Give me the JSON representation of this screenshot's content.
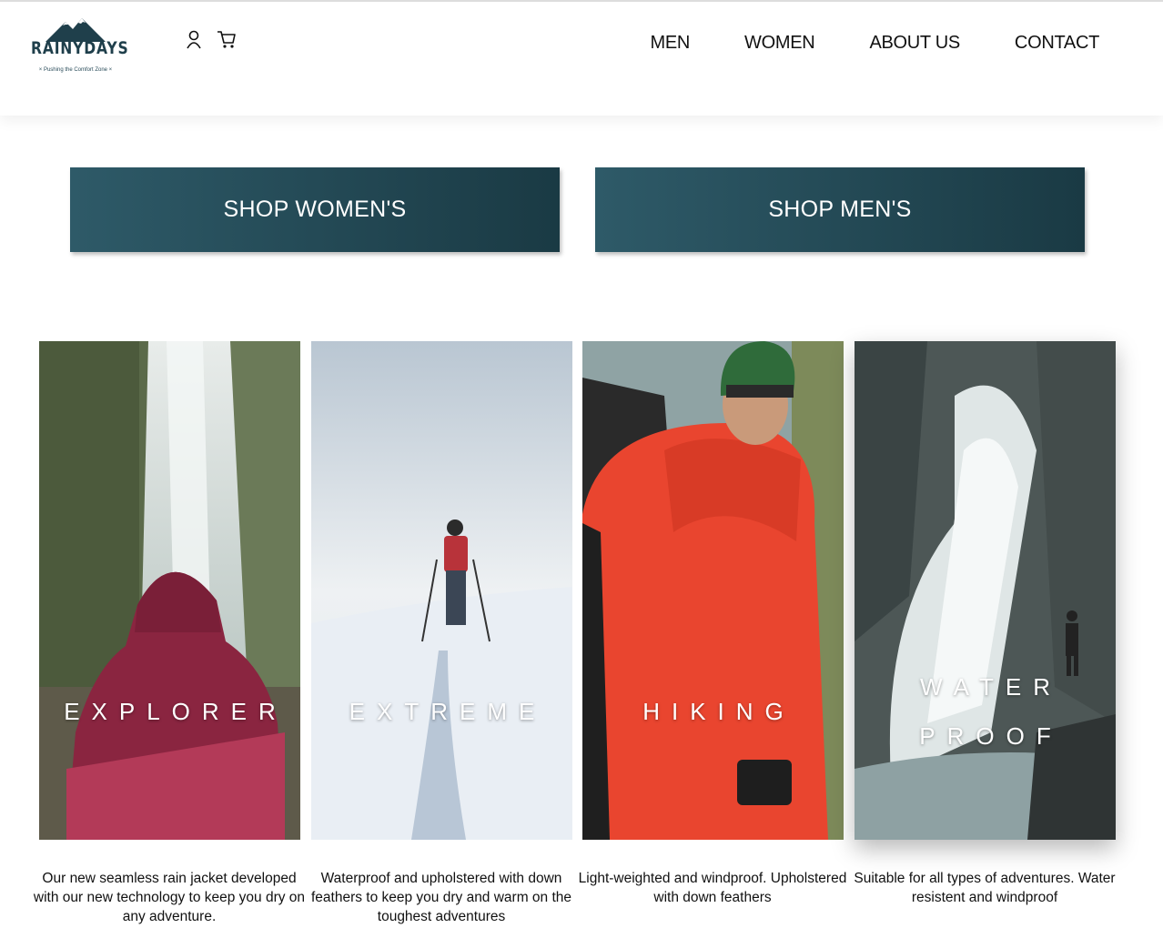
{
  "brand": {
    "name": "RAINYDAYS",
    "tagline": "× Pushing the Comfort Zone ×"
  },
  "header": {
    "icons": [
      "user-icon",
      "cart-icon"
    ],
    "nav": [
      "MEN",
      "WOMEN",
      "ABOUT US",
      "CONTACT"
    ]
  },
  "shop": {
    "women_label": "SHOP WOMEN'S",
    "men_label": "SHOP MEN'S"
  },
  "cards": [
    {
      "title": "EXPLORER",
      "desc": "Our new seamless rain jacket developed with our new technology to keep you dry on any adventure."
    },
    {
      "title": "EXTREME",
      "desc": "Waterproof and upholstered with down feathers to keep you dry and warm on the toughest adventures"
    },
    {
      "title": "HIKING",
      "desc": "Light-weighted and windproof. Upholstered with down feathers"
    },
    {
      "title_line1": "WATER",
      "title_line2": "PROOF",
      "desc": "Suitable for all types of adventures. Water resistent and windproof"
    }
  ],
  "colors": {
    "brand_dark": "#1f3f4b",
    "button_start": "#2e5a68",
    "button_end": "#1a3a44"
  }
}
